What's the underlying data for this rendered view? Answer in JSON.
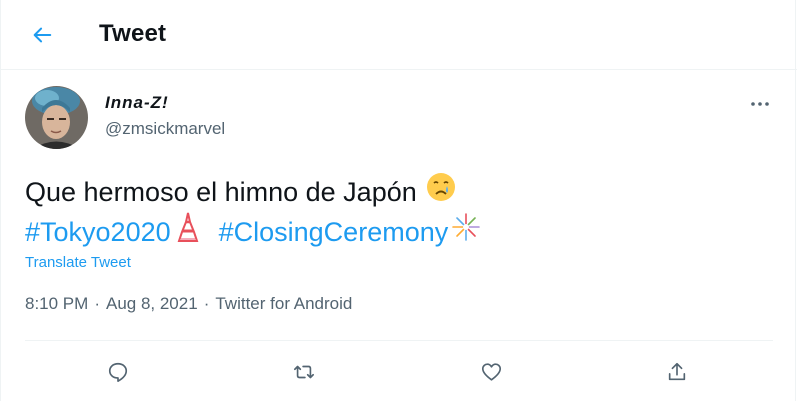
{
  "header": {
    "title": "Tweet",
    "back_icon": "arrow-left-icon",
    "accent": "#1d9bf0"
  },
  "tweet": {
    "author": {
      "display_name": "Inna-Z!",
      "handle": "@zmsickmarvel",
      "avatar_icon": "user-avatar"
    },
    "more_icon": "more-horizontal-icon",
    "text_line1": "Que hermoso el himno de Japón",
    "emoji1": "crying-face-emoji",
    "hashtag1": "#Tokyo2020",
    "emoji2": "tokyo-tower-emoji",
    "hashtag2": "#ClosingCeremony",
    "emoji3": "fireworks-emoji",
    "translate_label": "Translate Tweet",
    "time": "8:10 PM",
    "date": "Aug 8, 2021",
    "separator": "·",
    "source": "Twitter for Android"
  },
  "actions": [
    {
      "name": "reply",
      "icon": "reply-icon"
    },
    {
      "name": "retweet",
      "icon": "retweet-icon"
    },
    {
      "name": "like",
      "icon": "heart-icon"
    },
    {
      "name": "share",
      "icon": "share-icon"
    }
  ],
  "colors": {
    "text": "#0f1419",
    "secondary": "#536471",
    "link": "#1d9bf0",
    "border": "#eff3f4"
  }
}
